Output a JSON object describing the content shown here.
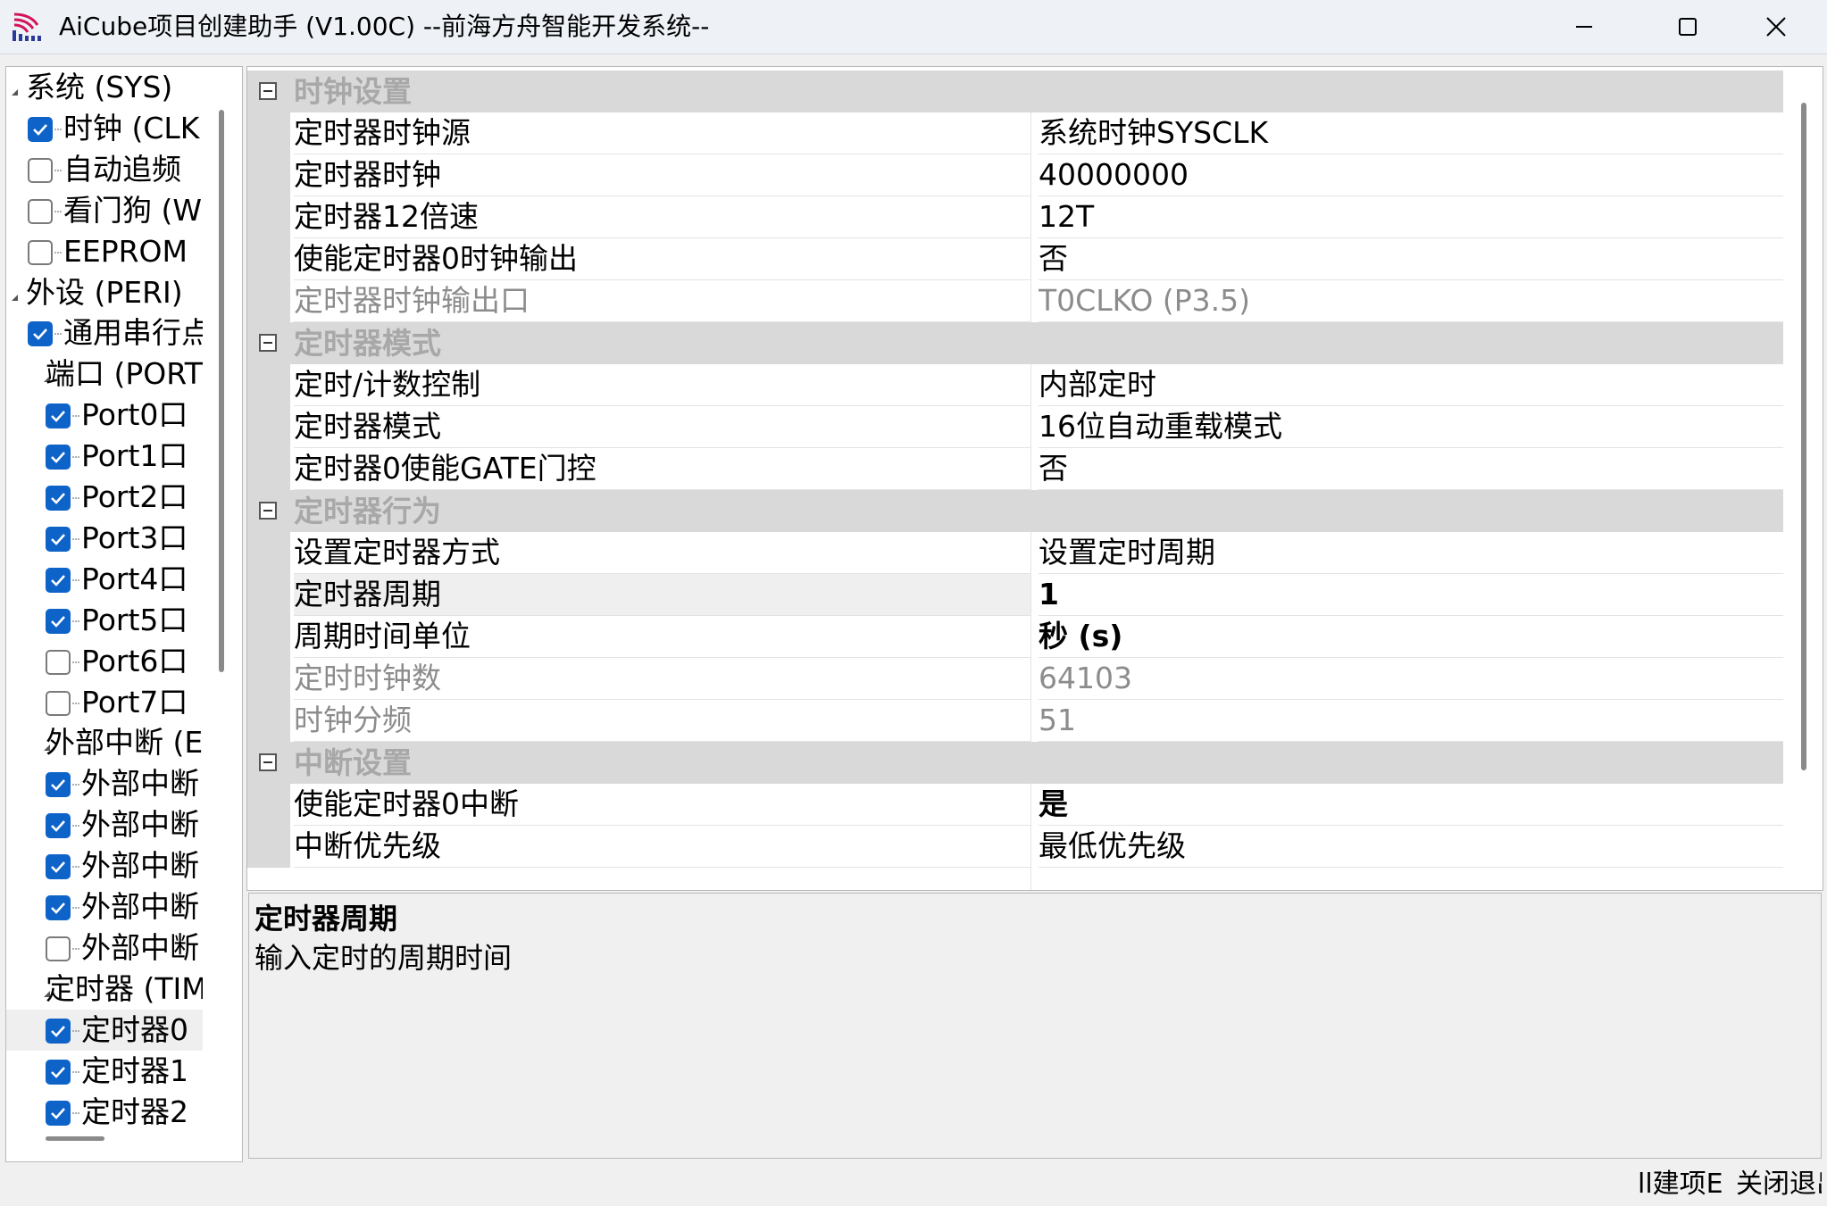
{
  "window": {
    "title": "AiCube项目创建助手 (V1.00C) --前海方舟智能开发系统--"
  },
  "tree": {
    "items": [
      {
        "label": "系统 (SYS)",
        "level": 0,
        "type": "group"
      },
      {
        "label": "时钟 (CLK",
        "level": 1,
        "type": "check",
        "checked": true
      },
      {
        "label": "自动追频",
        "level": 1,
        "type": "check",
        "checked": false
      },
      {
        "label": "看门狗 (W",
        "level": 1,
        "type": "check",
        "checked": false
      },
      {
        "label": "EEPROM",
        "level": 1,
        "type": "check",
        "checked": false
      },
      {
        "label": "外设 (PERI)",
        "level": 0,
        "type": "group"
      },
      {
        "label": "通用串行点",
        "level": 1,
        "type": "check",
        "checked": true
      },
      {
        "label": "端口 (PORT",
        "level": 1,
        "type": "group"
      },
      {
        "label": "Port0口",
        "level": 2,
        "type": "check",
        "checked": true
      },
      {
        "label": "Port1口",
        "level": 2,
        "type": "check",
        "checked": true
      },
      {
        "label": "Port2口",
        "level": 2,
        "type": "check",
        "checked": true
      },
      {
        "label": "Port3口",
        "level": 2,
        "type": "check",
        "checked": true
      },
      {
        "label": "Port4口",
        "level": 2,
        "type": "check",
        "checked": true
      },
      {
        "label": "Port5口",
        "level": 2,
        "type": "check",
        "checked": true
      },
      {
        "label": "Port6口",
        "level": 2,
        "type": "check",
        "checked": false
      },
      {
        "label": "Port7口",
        "level": 2,
        "type": "check",
        "checked": false
      },
      {
        "label": "外部中断 (E)",
        "level": 1,
        "type": "group"
      },
      {
        "label": "外部中断",
        "level": 2,
        "type": "check",
        "checked": true
      },
      {
        "label": "外部中断",
        "level": 2,
        "type": "check",
        "checked": true
      },
      {
        "label": "外部中断",
        "level": 2,
        "type": "check",
        "checked": true
      },
      {
        "label": "外部中断",
        "level": 2,
        "type": "check",
        "checked": true
      },
      {
        "label": "外部中断",
        "level": 2,
        "type": "check",
        "checked": false
      },
      {
        "label": "定时器 (TIM",
        "level": 1,
        "type": "group"
      },
      {
        "label": "定时器0",
        "level": 2,
        "type": "check",
        "checked": true,
        "selected": true
      },
      {
        "label": "定时器1",
        "level": 2,
        "type": "check",
        "checked": true
      },
      {
        "label": "定时器2",
        "level": 2,
        "type": "check",
        "checked": true
      }
    ]
  },
  "property_grid": {
    "categories": [
      {
        "label": "时钟设置",
        "props": [
          {
            "name": "定时器时钟源",
            "value": "系统时钟SYSCLK"
          },
          {
            "name": "定时器时钟",
            "value": "40000000"
          },
          {
            "name": "定时器12倍速",
            "value": "12T"
          },
          {
            "name": "使能定时器0时钟输出",
            "value": "否"
          },
          {
            "name": "定时器时钟输出口",
            "value": "T0CLKO (P3.5)",
            "disabled": true
          }
        ]
      },
      {
        "label": "定时器模式",
        "props": [
          {
            "name": "定时/计数控制",
            "value": "内部定时"
          },
          {
            "name": "定时器模式",
            "value": "16位自动重载模式"
          },
          {
            "name": "定时器0使能GATE门控",
            "value": "否"
          }
        ]
      },
      {
        "label": "定时器行为",
        "props": [
          {
            "name": "设置定时器方式",
            "value": "设置定时周期"
          },
          {
            "name": "定时器周期",
            "value": "1",
            "bold": true,
            "selected": true
          },
          {
            "name": "周期时间单位",
            "value": "秒 (s)",
            "bold": true
          },
          {
            "name": "定时时钟数",
            "value": "64103",
            "disabled": true
          },
          {
            "name": "时钟分频",
            "value": "51",
            "disabled": true
          }
        ]
      },
      {
        "label": "中断设置",
        "props": [
          {
            "name": "使能定时器0中断",
            "value": "是",
            "bold": true
          },
          {
            "name": "中断优先级",
            "value": "最低优先级"
          }
        ]
      }
    ]
  },
  "description": {
    "title": "定时器周期",
    "text": "输入定时的周期时间"
  },
  "buttons": {
    "create": "ll建项E",
    "close": "关闭退出"
  },
  "colors": {
    "accent": "#0e63c9",
    "category_bg": "#d9d9d9",
    "disabled_text": "#8c8c8c"
  }
}
